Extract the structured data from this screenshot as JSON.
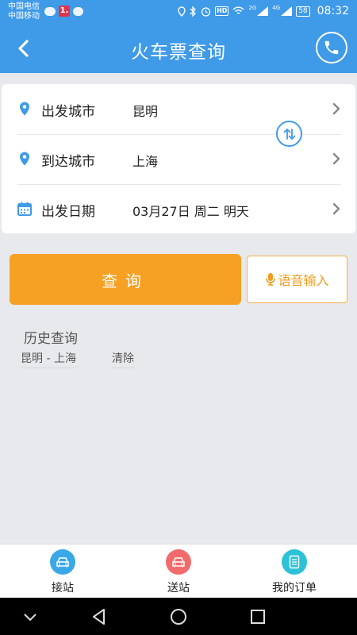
{
  "status_bar": {
    "carrier_1": "中国电信",
    "carrier_2": "中国移动",
    "notif_badge": "1.",
    "network_1": "2G",
    "network_2": "4G",
    "battery": "58",
    "time": "08:32",
    "hd": "HD"
  },
  "header": {
    "title": "火车票查询",
    "back_icon": "chevron-left-icon",
    "phone_icon": "phone-icon"
  },
  "form": {
    "departure": {
      "label": "出发城市",
      "value": "昆明",
      "icon": "location-pin-icon"
    },
    "arrival": {
      "label": "到达城市",
      "value": "上海",
      "icon": "location-pin-icon"
    },
    "date": {
      "label": "出发日期",
      "value": "03月27日 周二 明天",
      "icon": "calendar-icon"
    },
    "swap_icon": "swap-icon"
  },
  "actions": {
    "query": "查询",
    "voice": "语音输入",
    "voice_icon": "microphone-icon"
  },
  "history": {
    "title": "历史查询",
    "items": [
      "昆明 - 上海"
    ],
    "clear": "清除"
  },
  "bottom_nav": [
    {
      "label": "接站",
      "icon": "car-icon",
      "color": "#3aa8e8"
    },
    {
      "label": "送站",
      "icon": "car-icon",
      "color": "#f26b6b"
    },
    {
      "label": "我的订单",
      "icon": "document-icon",
      "color": "#2cc1d6"
    }
  ],
  "colors": {
    "primary": "#3f9ae8",
    "accent": "#f6a024",
    "background": "#e8e9ed"
  }
}
